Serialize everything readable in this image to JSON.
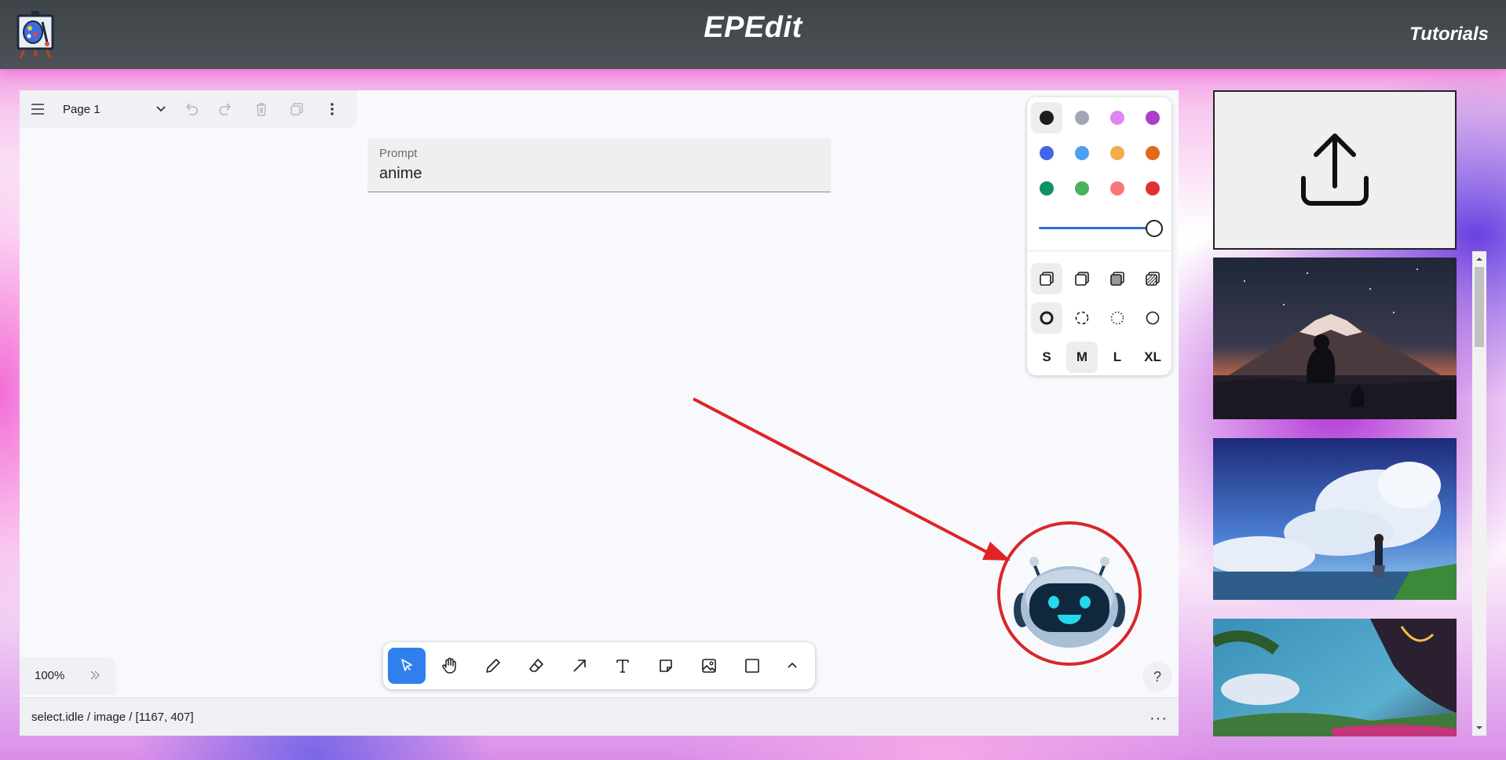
{
  "header": {
    "title": "EPEdit",
    "tutorials_label": "Tutorials",
    "logo_icon": "easel-palette-logo"
  },
  "canvas": {
    "page_name": "Page 1",
    "prompt": {
      "label": "Prompt",
      "value": "anime"
    },
    "zoom": "100%",
    "status": "select.idle / image / [1167, 407]",
    "help_label": "?",
    "status_more": "···"
  },
  "style_panel": {
    "colors": [
      "#1d1d1d",
      "#9fa8b2",
      "#e085f4",
      "#ae3ec9",
      "#4465e9",
      "#4ba1f1",
      "#f1ac4b",
      "#e16919",
      "#099268",
      "#4cb05e",
      "#f87777",
      "#e03131"
    ],
    "selected_color": "#1d1d1d",
    "fill_options": [
      "fill-none-icon",
      "fill-semi-icon",
      "fill-solid-icon",
      "fill-pattern-icon"
    ],
    "dash_options": [
      "dash-draw-icon",
      "dash-dashed-icon",
      "dash-dotted-icon",
      "dash-solid-icon"
    ],
    "sizes": [
      "S",
      "M",
      "L",
      "XL"
    ],
    "selected_size": "M",
    "opacity": 1.0
  },
  "toolbar": {
    "tools": [
      "select-icon",
      "hand-icon",
      "draw-icon",
      "eraser-icon",
      "arrow-icon",
      "text-icon",
      "note-icon",
      "image-icon",
      "rectangle-icon",
      "more-tools-icon"
    ],
    "active_tool": "select-icon"
  },
  "gallery": {
    "upload_icon": "upload-icon",
    "items": [
      "anime-mount-fuji-thumbnail",
      "anime-clouds-girl-thumbnail",
      "anime-landscape-thumbnail"
    ]
  },
  "colors": {
    "header_bg": "#464b50",
    "accent": "#2f80ed",
    "annotation_red": "#e02424"
  }
}
